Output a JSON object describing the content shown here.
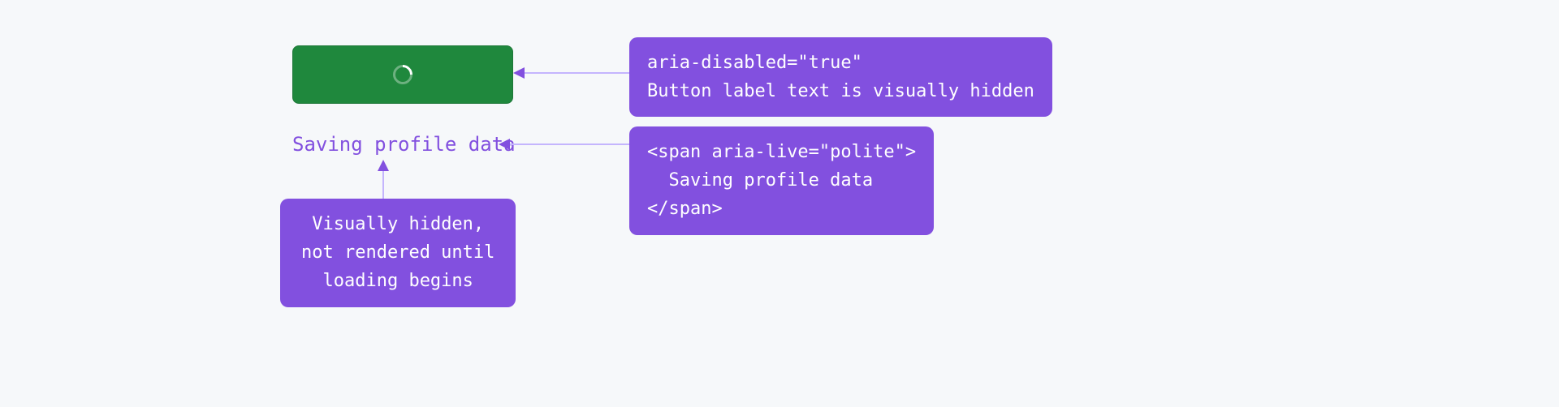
{
  "button": {
    "aria_disabled": "true"
  },
  "status": {
    "text": "Saving profile data"
  },
  "callouts": {
    "top": {
      "line1": "aria-disabled=\"true\"",
      "line2": "Button label text is visually hidden"
    },
    "middle": {
      "code": "<span aria-live=\"polite\">\n  Saving profile data\n</span>"
    },
    "bottom": {
      "line1": "Visually hidden,",
      "line2": "not rendered until",
      "line3": "loading begins"
    }
  }
}
